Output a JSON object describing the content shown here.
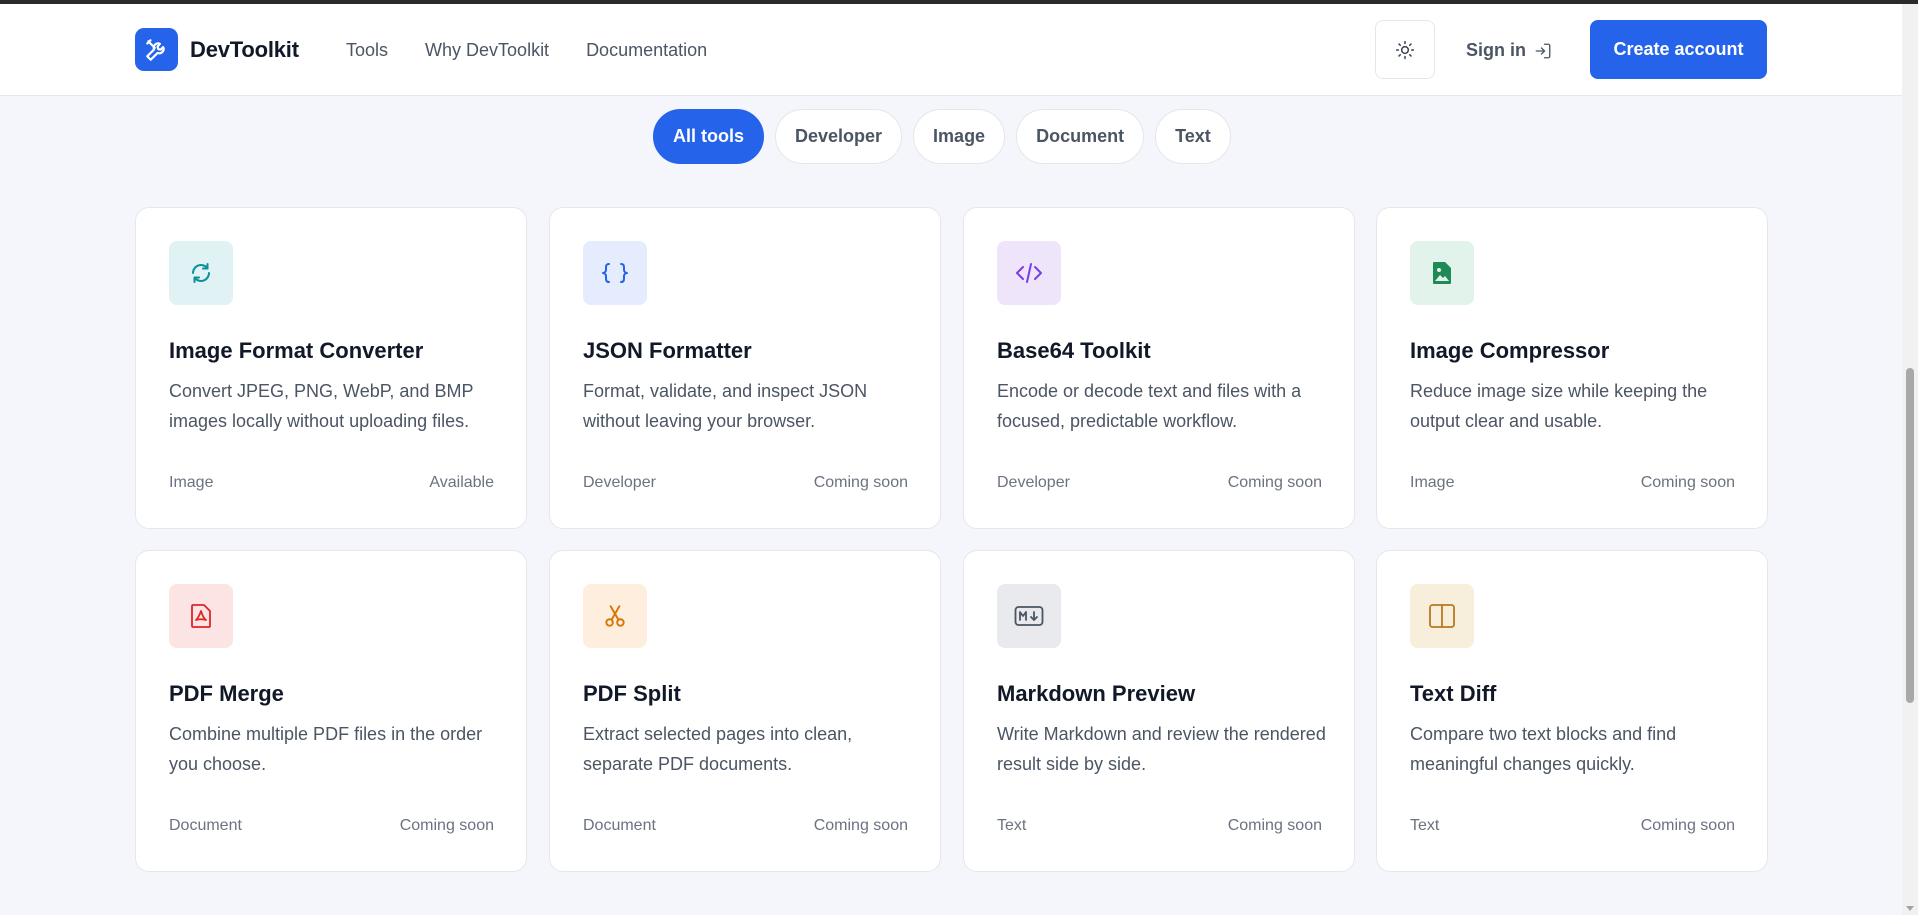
{
  "header": {
    "brand_name": "DevToolkit",
    "brand_icon": "wrench-screwdriver-icon",
    "nav": [
      "Tools",
      "Why DevToolkit",
      "Documentation"
    ],
    "theme_icon": "sun-icon",
    "signin_label": "Sign in",
    "signin_icon": "login-arrow-icon",
    "create_label": "Create account"
  },
  "filters": [
    "All tools",
    "Developer",
    "Image",
    "Document",
    "Text"
  ],
  "active_filter": "All tools",
  "cards": [
    {
      "title": "Image Format Converter",
      "desc": "Convert JPEG, PNG, WebP, and BMP images locally without uploading files.",
      "category": "Image",
      "status": "Available",
      "icon": "refresh-icon",
      "icon_bg": "#e0f2f4",
      "icon_color": "#0e8fa0"
    },
    {
      "title": "JSON Formatter",
      "desc": "Format, validate, and inspect JSON without leaving your browser.",
      "category": "Developer",
      "status": "Coming soon",
      "icon": "braces-icon",
      "icon_bg": "#e4ecfd",
      "icon_color": "#2563eb"
    },
    {
      "title": "Base64 Toolkit",
      "desc": "Encode or decode text and files with a focused, predictable workflow.",
      "category": "Developer",
      "status": "Coming soon",
      "icon": "code-icon",
      "icon_bg": "#efe5fb",
      "icon_color": "#7c3aed"
    },
    {
      "title": "Image Compressor",
      "desc": "Reduce image size while keeping the output clear and usable.",
      "category": "Image",
      "status": "Coming soon",
      "icon": "image-file-icon",
      "icon_bg": "#e1f3ea",
      "icon_color": "#1f8a55"
    },
    {
      "title": "PDF Merge",
      "desc": "Combine multiple PDF files in the order you choose.",
      "category": "Document",
      "status": "Coming soon",
      "icon": "pdf-file-icon",
      "icon_bg": "#fde4e4",
      "icon_color": "#dc2626"
    },
    {
      "title": "PDF Split",
      "desc": "Extract selected pages into clean, separate PDF documents.",
      "category": "Document",
      "status": "Coming soon",
      "icon": "scissors-icon",
      "icon_bg": "#fdeedd",
      "icon_color": "#d97706"
    },
    {
      "title": "Markdown Preview",
      "desc": "Write Markdown and review the rendered result side by side.",
      "category": "Text",
      "status": "Coming soon",
      "icon": "markdown-icon",
      "icon_bg": "#e8eaee",
      "icon_color": "#4b5563"
    },
    {
      "title": "Text Diff",
      "desc": "Compare two text blocks and find meaningful changes quickly.",
      "category": "Text",
      "status": "Coming soon",
      "icon": "split-columns-icon",
      "icon_bg": "#f7efdc",
      "icon_color": "#b7791f"
    }
  ]
}
